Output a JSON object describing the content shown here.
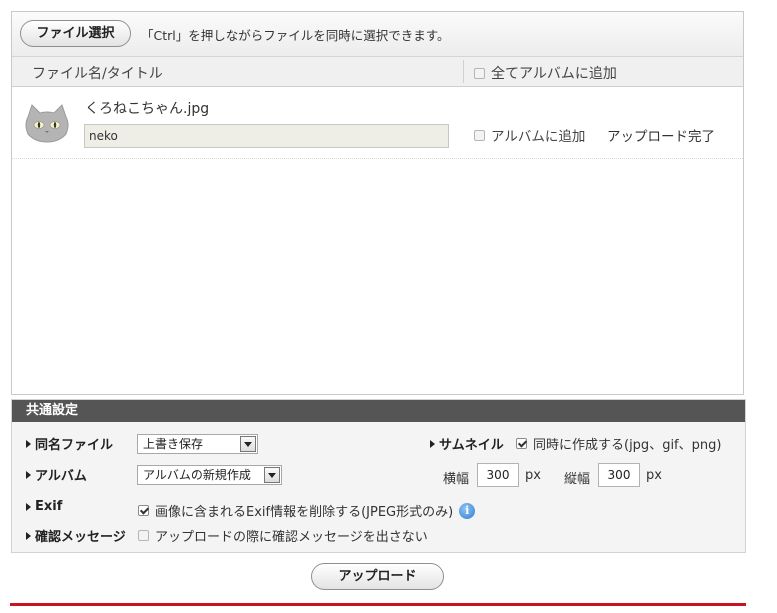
{
  "toolbar": {
    "select_file_label": "ファイル選択",
    "hint": "「Ctrl」を押しながらファイルを同時に選択できます。"
  },
  "columns": {
    "title_header": "ファイル名/タイトル",
    "add_all_label": "全てアルバムに追加"
  },
  "files": [
    {
      "file_name": "くろねこちゃん.jpg",
      "title_value": "neko",
      "add_to_album_label": "アルバムに追加",
      "status": "アップロード完了"
    }
  ],
  "settings": {
    "header": "共通設定",
    "same_name": {
      "label": "同名ファイル",
      "selected": "上書き保存"
    },
    "album": {
      "label": "アルバム",
      "selected": "アルバムの新規作成"
    },
    "exif": {
      "label": "Exif",
      "option": "画像に含まれるExif情報を削除する(JPEG形式のみ)",
      "checked": true
    },
    "confirm": {
      "label": "確認メッセージ",
      "option": "アップロードの際に確認メッセージを出さない",
      "checked": false
    },
    "thumbnail": {
      "label": "サムネイル",
      "option": "同時に作成する(jpg、gif、png)",
      "checked": true,
      "width_label": "横幅",
      "width_value": "300",
      "width_unit": "px",
      "height_label": "縦幅",
      "height_value": "300",
      "height_unit": "px"
    }
  },
  "upload_label": "アップロード",
  "icons": [
    "cat-thumbnail-icon",
    "info-icon",
    "triangle-right-icon",
    "dropdown-arrow-icon"
  ],
  "colors": {
    "header_bg": "#555555",
    "accent_line": "#cc1122",
    "info_blue": "#2f7dd1"
  }
}
